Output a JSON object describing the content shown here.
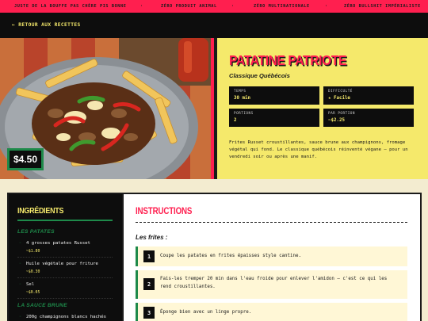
{
  "ticker": {
    "items": [
      "JUSTE DE LA BOUFFE PAS CHÈRE PIS BONNE",
      "·",
      "ZÉRO PRODUIT ANIMAL",
      "·",
      "ZÉRO MULTINATIONALE",
      "·",
      "ZÉRO BULLSHIT IMPÉRIALISTE"
    ]
  },
  "nav": {
    "back_label": "← RETOUR AUX RECETTES"
  },
  "hero": {
    "price": "$4.50",
    "title": "PATATINE PATRIOTE",
    "subtitle": "Classique Québécois",
    "stats": [
      {
        "label": "TEMPS",
        "value": "30 min"
      },
      {
        "label": "DIFFICULTÉ",
        "value": "★ Facile"
      },
      {
        "label": "PORTIONS",
        "value": "2"
      },
      {
        "label": "PAR PORTION",
        "value": "~$2.25"
      }
    ],
    "description": "Frites Russet croustillantes, sauce brune aux champignons, fromage végétal qui fond. Le classique québécois réinventé végane — pour un vendredi soir ou après une manif."
  },
  "ingredients": {
    "title": "INGRÉDIENTS",
    "sections": [
      {
        "name": "LES PATATES",
        "items": [
          {
            "name": "4 grosses patates Russet",
            "cost": "~$1.80"
          },
          {
            "name": "Huile végétale pour friture",
            "cost": "~$0.30"
          },
          {
            "name": "Sel",
            "cost": "~$0.05"
          }
        ]
      },
      {
        "name": "LA SAUCE BRUNE",
        "items": [
          {
            "name": "200g champignons blancs hachés",
            "cost": ""
          }
        ]
      }
    ]
  },
  "instructions": {
    "title": "INSTRUCTIONS",
    "section": "Les frites :",
    "steps": [
      {
        "num": "1",
        "text": "Coupe les patates en frites épaisses style cantine."
      },
      {
        "num": "2",
        "text": "Fais-les tremper 20 min dans l'eau froide pour enlever l'amidon — c'est ce qui les rend croustillantes."
      },
      {
        "num": "3",
        "text": "Éponge bien avec un linge propre."
      }
    ]
  },
  "colors": {
    "accent": "#ff1f4f",
    "yellow": "#f5e96b",
    "green": "#1e8a4a",
    "dark": "#0d0d0d"
  }
}
